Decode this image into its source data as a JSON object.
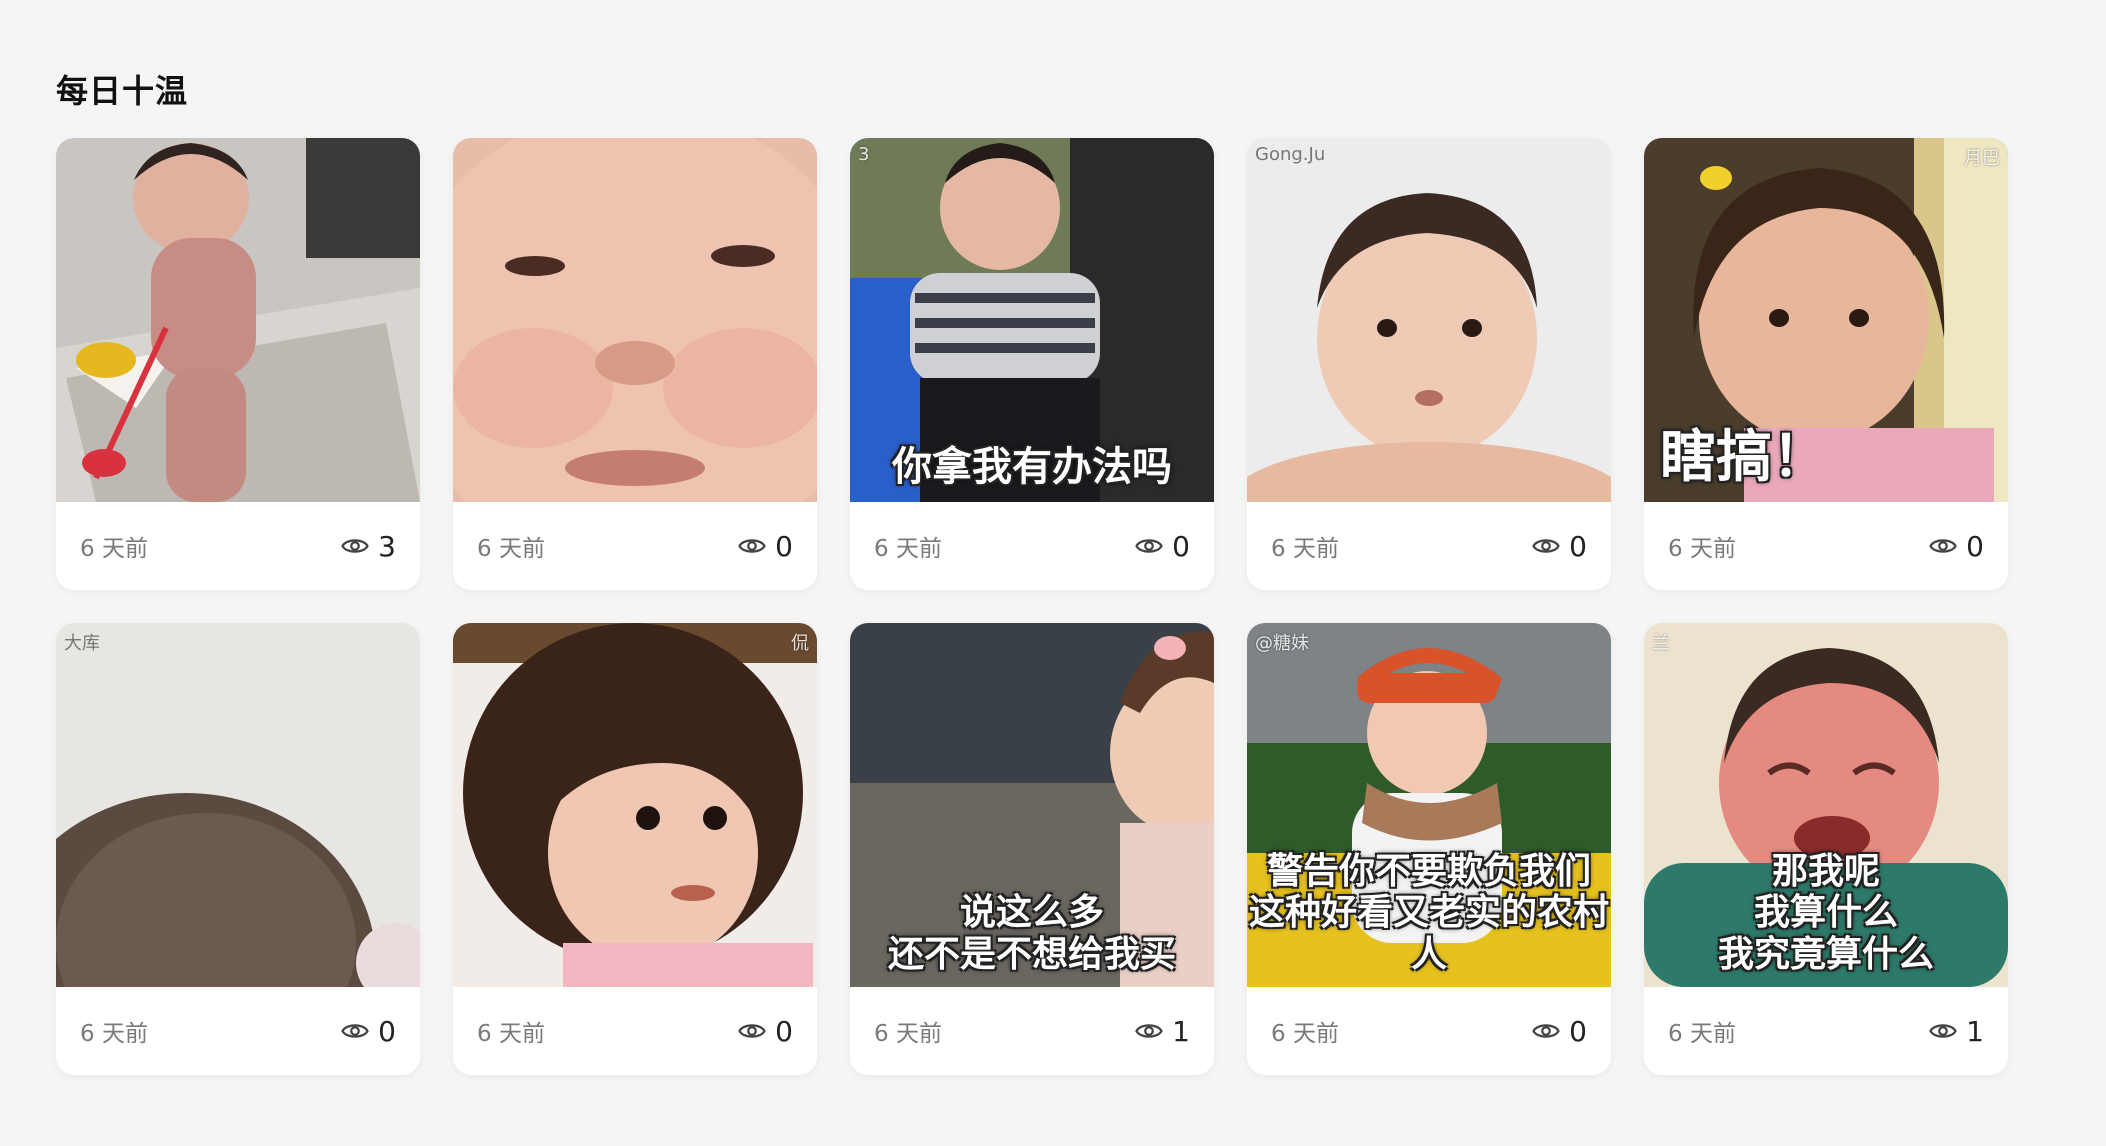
{
  "section": {
    "title": "每日十温"
  },
  "cards": [
    {
      "time": "6 天前",
      "views": "3",
      "caption": "",
      "watermark": ""
    },
    {
      "time": "6 天前",
      "views": "0",
      "caption": "",
      "watermark": ""
    },
    {
      "time": "6 天前",
      "views": "0",
      "caption": "你拿我有办法吗",
      "watermark": "3"
    },
    {
      "time": "6 天前",
      "views": "0",
      "caption": "",
      "watermark": "Gong.Ju"
    },
    {
      "time": "6 天前",
      "views": "0",
      "caption": "瞎搞！",
      "watermark": "月巴"
    },
    {
      "time": "6 天前",
      "views": "0",
      "caption": "",
      "watermark": "大库"
    },
    {
      "time": "6 天前",
      "views": "0",
      "caption": "",
      "watermark": "侃"
    },
    {
      "time": "6 天前",
      "views": "1",
      "caption": "说这么多\n还不是不想给我买",
      "watermark": ""
    },
    {
      "time": "6 天前",
      "views": "0",
      "caption": "警告你不要欺负我们\n这种好看又老实的农村人",
      "watermark": "@糖妹"
    },
    {
      "time": "6 天前",
      "views": "1",
      "caption": "那我呢\n我算什么\n我究竟算什么",
      "watermark": "兰"
    }
  ],
  "colors": {
    "background": "#f5f5f5",
    "card": "#ffffff",
    "meta_text": "#7a7a7a"
  }
}
